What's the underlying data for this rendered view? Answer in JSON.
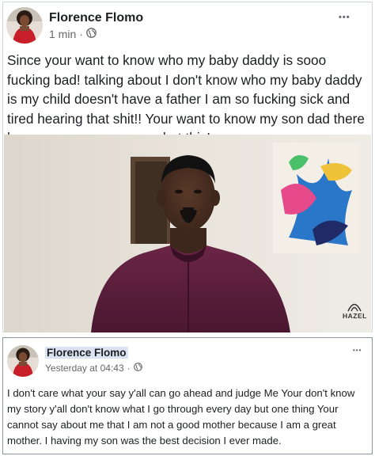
{
  "post1": {
    "author": "Florence Flomo",
    "time": "1 min",
    "separator": "·",
    "audience_icon": "globe-icon",
    "more_label": "•••",
    "text": "Since your want to know who my baby daddy is sooo fucking bad! talking about I don't know who my baby daddy is  my child doesn't have a father I am so fucking sick and tired hearing that shit!! Your want to know my son dad there he goes your can screenshot this!",
    "watermark": "HAZEL"
  },
  "post2": {
    "author": "Florence Flomo",
    "time": "Yesterday at 04:43",
    "separator": "·",
    "audience_icon": "globe-icon",
    "more_label": "•••",
    "text": "I don't care what your say y'all can go ahead and judge Me Your don't know my story y'all don't know what I go through every day but one thing Your cannot say about me that I am not a good mother because I am a great mother. I having my son was the best decision I ever made."
  },
  "colors": {
    "text": "#1c1e21",
    "meta": "#65676b",
    "name_highlight": "#dbe3f2",
    "shirt": "#5a1e3a"
  }
}
